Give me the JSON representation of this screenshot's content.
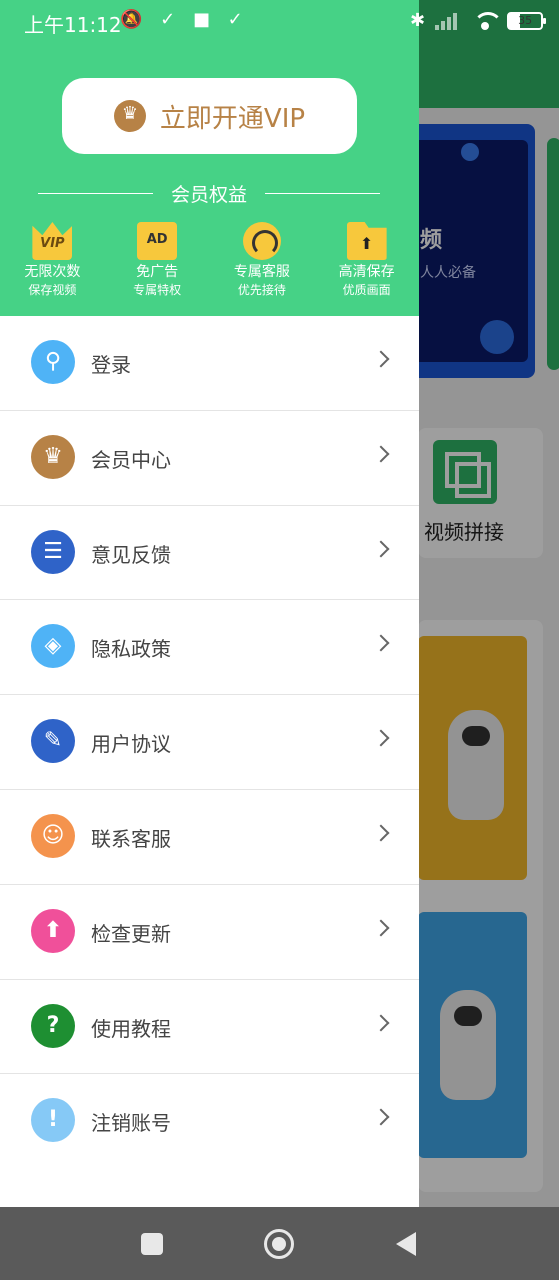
{
  "status_bar": {
    "time": "上午11:12",
    "left_icons": "🔕 ✓ ■ ✓",
    "battery": "35",
    "bluetooth": "✱"
  },
  "drawer": {
    "vip_button": "立即开通VIP",
    "benefits_title": "会员权益",
    "benefits": [
      {
        "title": "无限次数",
        "sub": "保存视频",
        "icon": "vip-crown-icon",
        "icon_text": "VIP"
      },
      {
        "title": "免广告",
        "sub": "专属特权",
        "icon": "ad-icon",
        "icon_text": "AD"
      },
      {
        "title": "专属客服",
        "sub": "优先接待",
        "icon": "headset-icon",
        "icon_text": ""
      },
      {
        "title": "高清保存",
        "sub": "优质画面",
        "icon": "folder-upload-icon",
        "icon_text": "⬆"
      }
    ],
    "menu": [
      {
        "label": "登录",
        "icon": "keyhole-icon",
        "glyph": "⚲",
        "color": "#4fb3f6"
      },
      {
        "label": "会员中心",
        "icon": "crown-icon",
        "glyph": "♛",
        "color": "#b78246"
      },
      {
        "label": "意见反馈",
        "icon": "chat-icon",
        "glyph": "☰",
        "color": "#2f63c8"
      },
      {
        "label": "隐私政策",
        "icon": "shield-icon",
        "glyph": "◈",
        "color": "#4fb3f6"
      },
      {
        "label": "用户协议",
        "icon": "document-edit-icon",
        "glyph": "✎",
        "color": "#2f63c8"
      },
      {
        "label": "联系客服",
        "icon": "support-agent-icon",
        "glyph": "☺",
        "color": "#f4934d"
      },
      {
        "label": "检查更新",
        "icon": "upload-arrow-icon",
        "glyph": "⬆",
        "color": "#f0509a"
      },
      {
        "label": "使用教程",
        "icon": "question-icon",
        "glyph": "?",
        "color": "#1e8f32"
      },
      {
        "label": "注销账号",
        "icon": "exclamation-icon",
        "glyph": "!",
        "color": "#86c9f6"
      }
    ]
  },
  "background": {
    "card_title": "频",
    "card_sub": "人人必备",
    "tool_label": "视频拼接"
  }
}
